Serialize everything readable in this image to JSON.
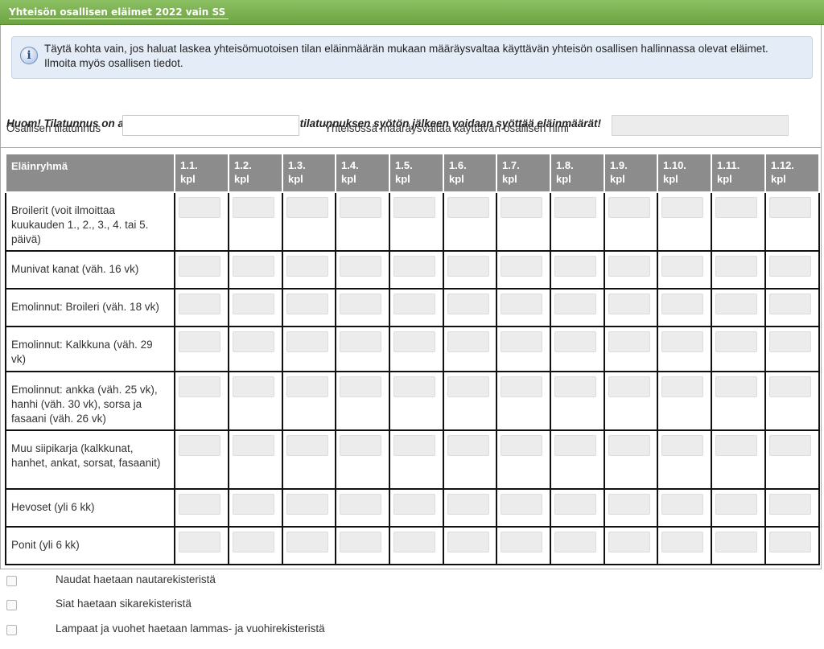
{
  "header": {
    "title": "Yhteisön osallisen eläimet 2022 vain SS"
  },
  "info": {
    "icon": "info-icon",
    "text": "Täytä kohta vain, jos haluat laskea yhteisömuotoisen tilan eläinmäärän mukaan määräysvaltaa käyttävän yhteisön osallisen hallinnassa olevat eläimet. Ilmoita myös osallisen tiedot."
  },
  "notice": "Huom! Tilatunnus on annettava ensin. Vasta hyväksytyn tilatunnuksen syötön jälkeen voidaan syöttää eläinmäärät!",
  "form": {
    "farm_id_label": "Osallisen tilatunnus",
    "farm_id_value": "",
    "name_label": "Yhteisössä määräysvaltaa käyttävän osallisen nimi",
    "name_value": ""
  },
  "table": {
    "first_header": "Eläinryhmä",
    "columns": [
      [
        "1.1.",
        "kpl"
      ],
      [
        "1.2.",
        "kpl"
      ],
      [
        "1.3.",
        "kpl"
      ],
      [
        "1.4.",
        "kpl"
      ],
      [
        "1.5.",
        "kpl"
      ],
      [
        "1.6.",
        "kpl"
      ],
      [
        "1.7.",
        "kpl"
      ],
      [
        "1.8.",
        "kpl"
      ],
      [
        "1.9.",
        "kpl"
      ],
      [
        "1.10.",
        "kpl"
      ],
      [
        "1.11.",
        "kpl"
      ],
      [
        "1.12.",
        "kpl"
      ]
    ],
    "rows": [
      "Broilerit (voit ilmoittaa kuukauden 1., 2., 3., 4. tai 5. päivä)",
      "Munivat kanat (väh. 16 vk)",
      "Emolinnut: Broileri (väh. 18 vk)",
      "Emolinnut: Kalkkuna (väh. 29 vk)",
      "Emolinnut: ankka (väh. 25 vk), hanhi (väh. 30 vk), sorsa ja fasaani (väh. 26 vk)",
      "Muu siipikarja (kalkkunat, hanhet, ankat, sorsat, fasaanit)",
      "Hevoset (yli 6 kk)",
      "Ponit (yli 6 kk)"
    ]
  },
  "checkboxes": [
    {
      "label": "Naudat haetaan nautarekisteristä",
      "checked": false
    },
    {
      "label": "Siat haetaan sikarekisteristä",
      "checked": false
    },
    {
      "label": "Lampaat ja vuohet haetaan lammas- ja vuohirekisteristä",
      "checked": false
    }
  ]
}
